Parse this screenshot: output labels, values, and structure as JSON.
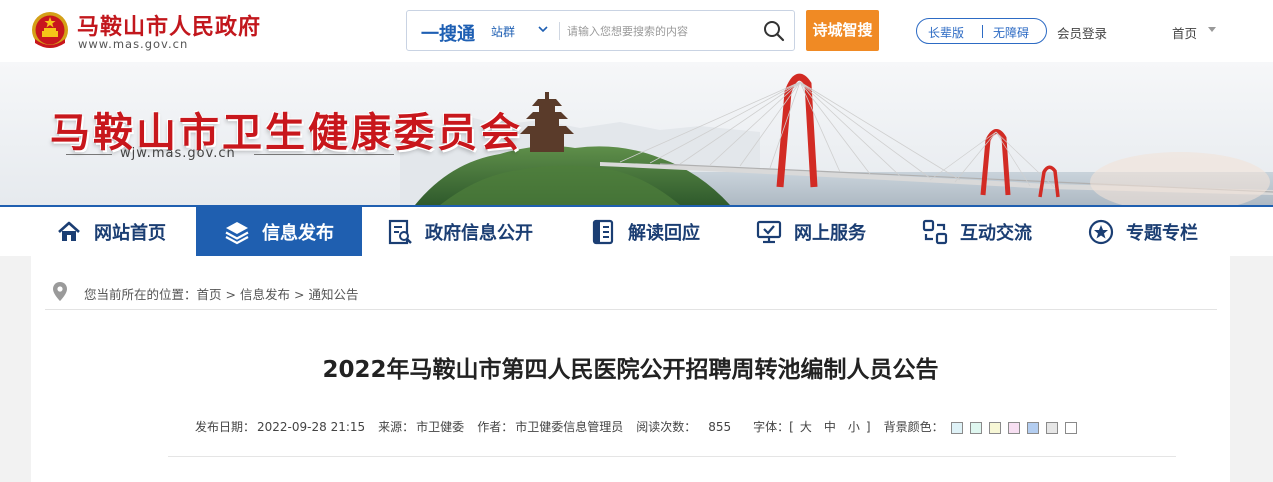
{
  "header": {
    "site_name": "马鞍山市人民政府",
    "site_url": "www.mas.gov.cn",
    "search": {
      "brand": "一搜通",
      "scope": "站群",
      "placeholder": "请输入您想要搜索的内容"
    },
    "smart_search_label": "诗城智搜",
    "elder_mode_label": "长辈版",
    "accessibility_label": "无障碍",
    "login_label": "会员登录",
    "home_label": "首页"
  },
  "banner": {
    "department": "马鞍山市卫生健康委员会",
    "url": "wjw.mas.gov.cn"
  },
  "nav": {
    "items": [
      {
        "label": "网站首页",
        "icon": "home-icon"
      },
      {
        "label": "信息发布",
        "icon": "layers-icon"
      },
      {
        "label": "政府信息公开",
        "icon": "document-search-icon"
      },
      {
        "label": "解读回应",
        "icon": "book-icon"
      },
      {
        "label": "网上服务",
        "icon": "monitor-check-icon"
      },
      {
        "label": "互动交流",
        "icon": "interaction-icon"
      },
      {
        "label": "专题专栏",
        "icon": "star-circle-icon"
      }
    ],
    "active_index": 1
  },
  "breadcrumb": {
    "prefix": "您当前所在的位置：",
    "items": [
      "首页",
      "信息发布",
      "通知公告"
    ],
    "separator": ">"
  },
  "article": {
    "title": "2022年马鞍山市第四人民医院公开招聘周转池编制人员公告",
    "meta": {
      "date_label": "发布日期：",
      "date": "2022-09-28 21:15",
      "source_label": "来源：",
      "source": "市卫健委",
      "author_label": "作者：",
      "author": "市卫健委信息管理员",
      "views_label": "阅读次数：",
      "views": "855",
      "font_label": "字体：",
      "font_open": "[",
      "font_large": "大",
      "font_medium": "中",
      "font_small": "小",
      "font_close": "]",
      "bg_label": "背景颜色："
    },
    "bg_swatches": [
      "#dff2f7",
      "#dff7f0",
      "#f7f7d6",
      "#f7dff2",
      "#b3cdf0",
      "#e6e6e6",
      "#ffffff"
    ]
  },
  "colors": {
    "brand_red": "#c2171d",
    "nav_blue": "#1f5fb0",
    "nav_text": "#1b3e73",
    "accent_orange": "#f08a24"
  }
}
